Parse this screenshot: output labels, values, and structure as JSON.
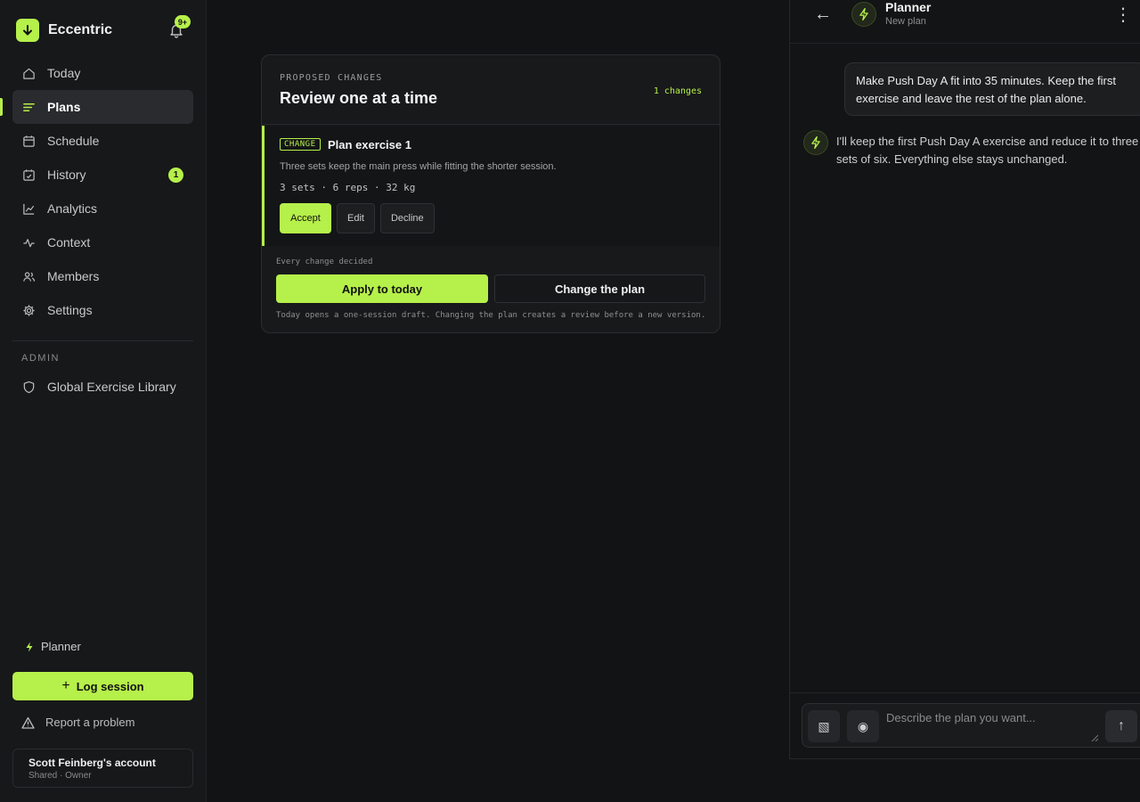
{
  "brand": {
    "name": "Eccentric",
    "notifications_badge": "9+"
  },
  "nav": [
    {
      "label": "Today",
      "icon": "home-icon"
    },
    {
      "label": "Plans",
      "icon": "list-icon",
      "active": true
    },
    {
      "label": "Schedule",
      "icon": "calendar-icon"
    },
    {
      "label": "History",
      "icon": "calendar-check-icon",
      "badge": "1"
    },
    {
      "label": "Analytics",
      "icon": "chart-line-icon"
    },
    {
      "label": "Context",
      "icon": "pulse-icon"
    },
    {
      "label": "Members",
      "icon": "users-icon"
    },
    {
      "label": "Settings",
      "icon": "gear-icon"
    }
  ],
  "admin": {
    "heading": "ADMIN",
    "items": [
      {
        "label": "Global Exercise Library",
        "icon": "shield-icon"
      }
    ]
  },
  "sidebar_footer": {
    "planner_label": "Planner",
    "log_session_label": "Log session",
    "report_label": "Report a problem",
    "account_name": "Scott Feinberg's account",
    "account_sub": "Shared · Owner"
  },
  "review": {
    "eyebrow": "PROPOSED CHANGES",
    "title": "Review one at a time",
    "count": "1 changes",
    "change": {
      "tag": "CHANGE",
      "title": "Plan exercise 1",
      "description": "Three sets keep the main press while fitting the shorter session.",
      "meta": "3 sets · 6 reps · 32 kg",
      "accept_label": "Accept",
      "edit_label": "Edit",
      "decline_label": "Decline"
    },
    "footer_label": "Every change decided",
    "apply_label": "Apply to today",
    "change_plan_label": "Change the plan",
    "footer_note": "Today opens a one-session draft. Changing the plan creates a review before a new version."
  },
  "chat": {
    "title": "Planner",
    "subtitle": "New plan",
    "user_message": "Make Push Day A fit into 35 minutes. Keep the first exercise and leave the rest of the plan alone.",
    "bot_message": "I'll keep the first Push Day A exercise and reduce it to three sets of six. Everything else stays unchanged.",
    "input_placeholder": "Describe the plan you want..."
  },
  "colors": {
    "accent": "#b6f04a",
    "background": "#121314",
    "sidebar": "#17181a"
  }
}
